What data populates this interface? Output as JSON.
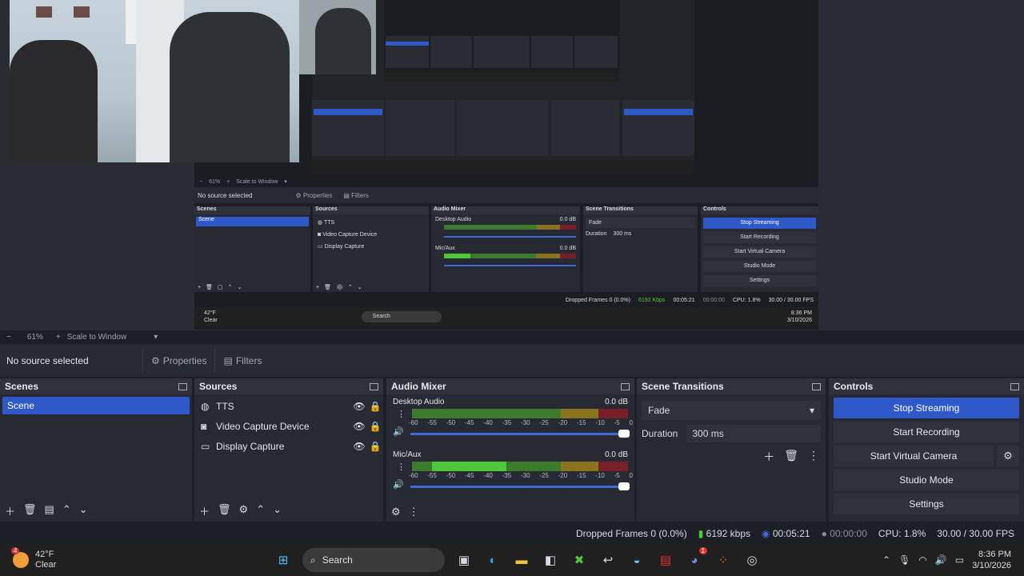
{
  "preview": {
    "nested_zoom": "61%",
    "nested_scale": "Scale to Window",
    "nested_no_source": "No source selected",
    "nested_properties": "Properties",
    "nested_filters": "Filters",
    "nested_scenes": "Scenes",
    "nested_sources": "Sources",
    "nested_audio_mixer": "Audio Mixer",
    "nested_transitions": "Scene Transitions",
    "nested_controls": "Controls",
    "nested_scene_item": "Scene",
    "nested_sources_list": [
      "TTS",
      "Video Capture Device",
      "Display Capture"
    ],
    "nested_desktop_audio": "Desktop Audio",
    "nested_mic": "Mic/Aux",
    "nested_db": "0.0 dB",
    "nested_fade": "Fade",
    "nested_duration": "Duration",
    "nested_duration_val": "300 ms",
    "nested_controls_list": [
      "Stop Streaming",
      "Start Recording",
      "Start Virtual Camera",
      "Studio Mode",
      "Settings"
    ],
    "nested_status": "Dropped Frames 0 (0.0%)",
    "nested_kbps": "6192 Kbps",
    "nested_time": "00:05:21",
    "nested_rec_time": "00:00:00",
    "nested_cpu": "CPU: 1.8%",
    "nested_fps": "30.00 / 30.00 FPS",
    "nested_weather_temp": "42°F",
    "nested_weather_cond": "Clear",
    "nested_search": "Search",
    "nested_clock_time": "8:36 PM",
    "nested_clock_date": "3/10/2026"
  },
  "zoombar": {
    "minus": "−",
    "zoom": "61%",
    "plus": "+",
    "scale": "Scale to Window",
    "chevron": "▾"
  },
  "ctxbar": {
    "no_source": "No source selected",
    "properties": "Properties",
    "filters": "Filters"
  },
  "scenes": {
    "title": "Scenes",
    "items": [
      "Scene"
    ]
  },
  "sources": {
    "title": "Sources",
    "items": [
      {
        "label": "TTS",
        "icon": "globe-icon"
      },
      {
        "label": "Video Capture Device",
        "icon": "camera-icon"
      },
      {
        "label": "Display Capture",
        "icon": "monitor-icon"
      }
    ]
  },
  "mixer": {
    "title": "Audio Mixer",
    "channels": [
      {
        "name": "Desktop Audio",
        "db": "0.0 dB"
      },
      {
        "name": "Mic/Aux",
        "db": "0.0 dB"
      }
    ],
    "ticks": [
      "-60",
      "-55",
      "-50",
      "-45",
      "-40",
      "-35",
      "-30",
      "-25",
      "-20",
      "-15",
      "-10",
      "-5",
      "0"
    ]
  },
  "transitions": {
    "title": "Scene Transitions",
    "selected": "Fade",
    "duration_label": "Duration",
    "duration_value": "300 ms"
  },
  "controls": {
    "title": "Controls",
    "stop_streaming": "Stop Streaming",
    "start_recording": "Start Recording",
    "start_virtual_camera": "Start Virtual Camera",
    "studio_mode": "Studio Mode",
    "settings": "Settings"
  },
  "status": {
    "dropped": "Dropped Frames 0 (0.0%)",
    "kbps": "6192 kbps",
    "stream_time": "00:05:21",
    "rec_time": "00:00:00",
    "cpu": "CPU: 1.8%",
    "fps": "30.00 / 30.00 FPS"
  },
  "taskbar": {
    "weather_badge": "4",
    "weather_temp": "42°F",
    "weather_cond": "Clear",
    "search": "Search",
    "discord_badge": "1",
    "clock_time": "8:36 PM",
    "clock_date": "3/10/2026"
  },
  "colors": {
    "accent": "#2f59c9",
    "meter_green": "#4fc73a",
    "panel": "#272a33",
    "background": "#1d1f26"
  }
}
